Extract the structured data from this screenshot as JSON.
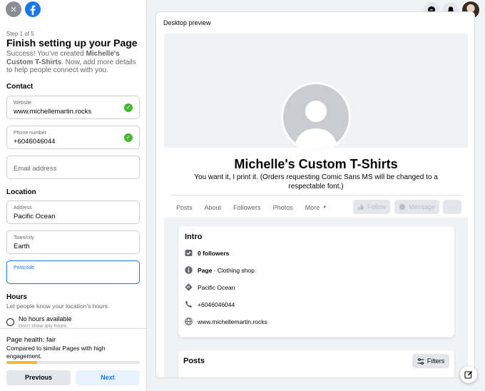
{
  "setup": {
    "step": "Step 1 of 5",
    "title": "Finish setting up your Page",
    "success_prefix": "Success! You've created ",
    "page_name": "Michelle's Custom T-Shirts",
    "success_suffix": ". Now, add more details to help people connect with you.",
    "contact_heading": "Contact",
    "website_label": "Website",
    "website_value": "www.michellemartin.rocks",
    "phone_label": "Phone number",
    "phone_value": "+6046046044",
    "email_placeholder": "Email address",
    "location_heading": "Location",
    "address_label": "Address",
    "address_value": "Pacific Ocean",
    "city_label": "Town/city",
    "city_value": "Earth",
    "postcode_label": "Postcode",
    "hours_heading": "Hours",
    "hours_sub": "Let people know your location's hours.",
    "no_hours_label": "No hours available",
    "no_hours_sub": "Don't show any hours."
  },
  "health": {
    "title": "Page health: fair",
    "subtitle": "Compared to similar Pages with high engagement.",
    "progress": 0.23,
    "previous_label": "Previous",
    "next_label": "Next"
  },
  "preview": {
    "label": "Desktop preview",
    "page_name": "Michelle's Custom T-Shirts",
    "description": "You want it, I print it. (Orders requesting Comic Sans MS will be changed to a respectable font.)",
    "tabs": [
      "Posts",
      "About",
      "Followers",
      "Photos",
      "More"
    ],
    "follow_label": "Follow",
    "message_label": "Message",
    "more_options_label": "···",
    "intro": {
      "title": "Intro",
      "followers": "0 followers",
      "category_bold": "Page",
      "category_rest": " · Clothing shop",
      "location": "Pacific Ocean",
      "phone": "+6046046044",
      "website": "www.michellemartin.rocks"
    },
    "posts_title": "Posts",
    "filters_label": "Filters"
  },
  "colors": {
    "brand": "#1877f2",
    "success": "#42b72a",
    "health_bar": "#f7b928"
  },
  "icons": [
    "close-icon",
    "facebook-logo-icon",
    "messenger-icon",
    "notifications-bell-icon",
    "desktop-icon",
    "mobile-icon",
    "check-icon",
    "edit-icon"
  ]
}
